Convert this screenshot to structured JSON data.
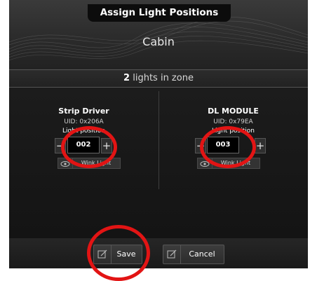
{
  "header": {
    "title": "Assign Light Positions",
    "zone_name": "Cabin"
  },
  "zone_summary": {
    "count": "2",
    "suffix": "lights in zone"
  },
  "lights": [
    {
      "name": "Strip Driver",
      "uid": "UID: 0x206A",
      "position_label": "Light position",
      "position_value": "002",
      "decrement_label": "−",
      "increment_label": "+",
      "wink_label": "Wink Light"
    },
    {
      "name": "DL MODULE",
      "uid": "UID: 0x79EA",
      "position_label": "Light position",
      "position_value": "003",
      "decrement_label": "−",
      "increment_label": "+",
      "wink_label": "Wink Light"
    }
  ],
  "footer": {
    "save_label": "Save",
    "cancel_label": "Cancel"
  },
  "colors": {
    "annotation_ring": "#e21414",
    "background": "#121212"
  },
  "icons": {
    "wink": "eye-icon",
    "save": "edit-icon",
    "cancel": "edit-icon"
  }
}
